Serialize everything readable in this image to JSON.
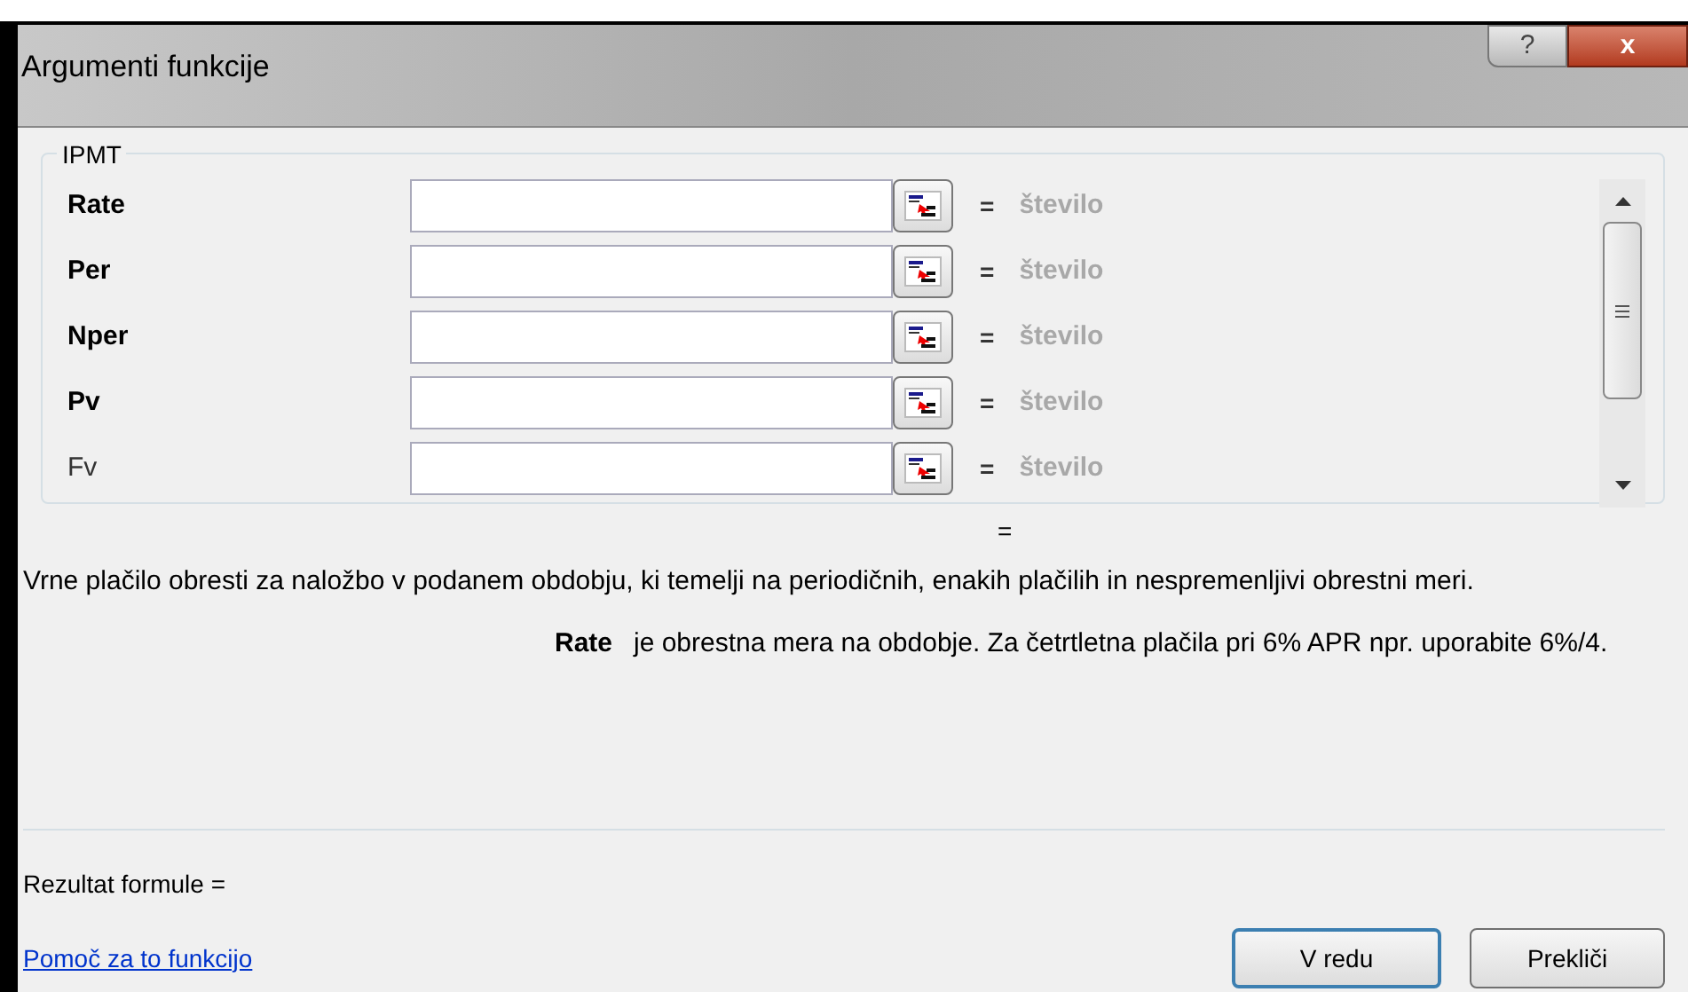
{
  "window": {
    "title": "Argumenti funkcije",
    "buttons": [
      "?",
      "x"
    ]
  },
  "function_name": "IPMT",
  "arguments": [
    {
      "name": "Rate",
      "required": true,
      "result": "število"
    },
    {
      "name": "Per",
      "required": true,
      "result": "število"
    },
    {
      "name": "Nper",
      "required": true,
      "result": "število"
    },
    {
      "name": "Pv",
      "required": true,
      "result": "število"
    },
    {
      "name": "Fv",
      "required": false,
      "result": "število"
    }
  ],
  "equals": "=",
  "function_result": "=",
  "description": "Vrne plačilo obresti za naložbo v podanem obdobju, ki temelji na periodičnih, enakih plačilih in nespremenljivi obrestni meri.",
  "argument_help": {
    "name": "Rate",
    "text": "je obrestna mera na obdobje. Za četrtletna plačila pri 6% APR npr. uporabite 6%/4."
  },
  "formula_result": "Rezultat formule =",
  "help_link": "Pomoč za to funkcijo",
  "buttons": [
    {
      "label": "V redu",
      "default": true
    },
    {
      "label": "Prekliči",
      "default": false
    }
  ]
}
